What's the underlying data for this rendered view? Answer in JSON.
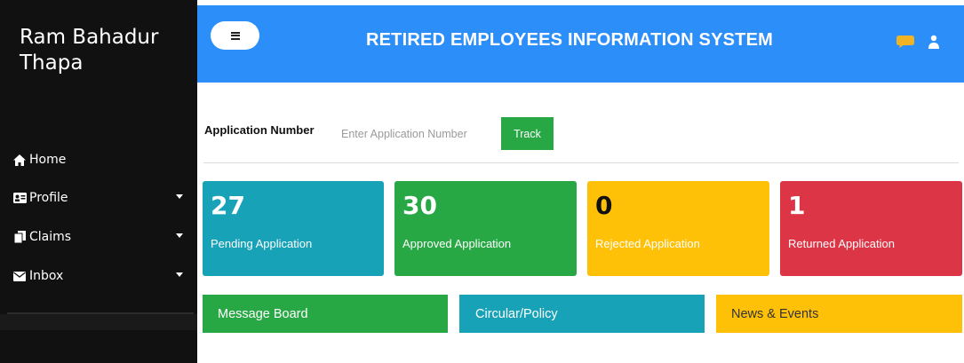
{
  "sidebar": {
    "user_name": "Ram Bahadur Thapa",
    "items": [
      {
        "label": "Home",
        "icon": "home-icon",
        "has_dropdown": false
      },
      {
        "label": "Profile",
        "icon": "id-card-icon",
        "has_dropdown": true
      },
      {
        "label": "Claims",
        "icon": "documents-icon",
        "has_dropdown": true
      },
      {
        "label": "Inbox",
        "icon": "envelope-icon",
        "has_dropdown": true
      }
    ]
  },
  "header": {
    "title": "RETIRED EMPLOYEES INFORMATION SYSTEM",
    "menu_icon": "hamburger-icon",
    "chat_icon": "chat-icon",
    "user_icon": "user-icon"
  },
  "tracking": {
    "label": "Application Number",
    "placeholder": "Enter Application Number",
    "value": "",
    "button_label": "Track"
  },
  "stats": {
    "pending": {
      "count": "27",
      "label": "Pending Application"
    },
    "approved": {
      "count": "30",
      "label": "Approved Application"
    },
    "rejected": {
      "count": "0",
      "label": "Rejected Application"
    },
    "returned": {
      "count": "1",
      "label": "Returned Application"
    }
  },
  "tiles": {
    "message_board": "Message Board",
    "circular_policy": "Circular/Policy",
    "news_events": "News & Events"
  },
  "colors": {
    "header_blue": "#2c8ef8",
    "sidebar_black": "#111111",
    "info": "#17a2b8",
    "success": "#28a745",
    "warning": "#ffc107",
    "danger": "#dc3545",
    "chat_icon": "#f0b323"
  }
}
